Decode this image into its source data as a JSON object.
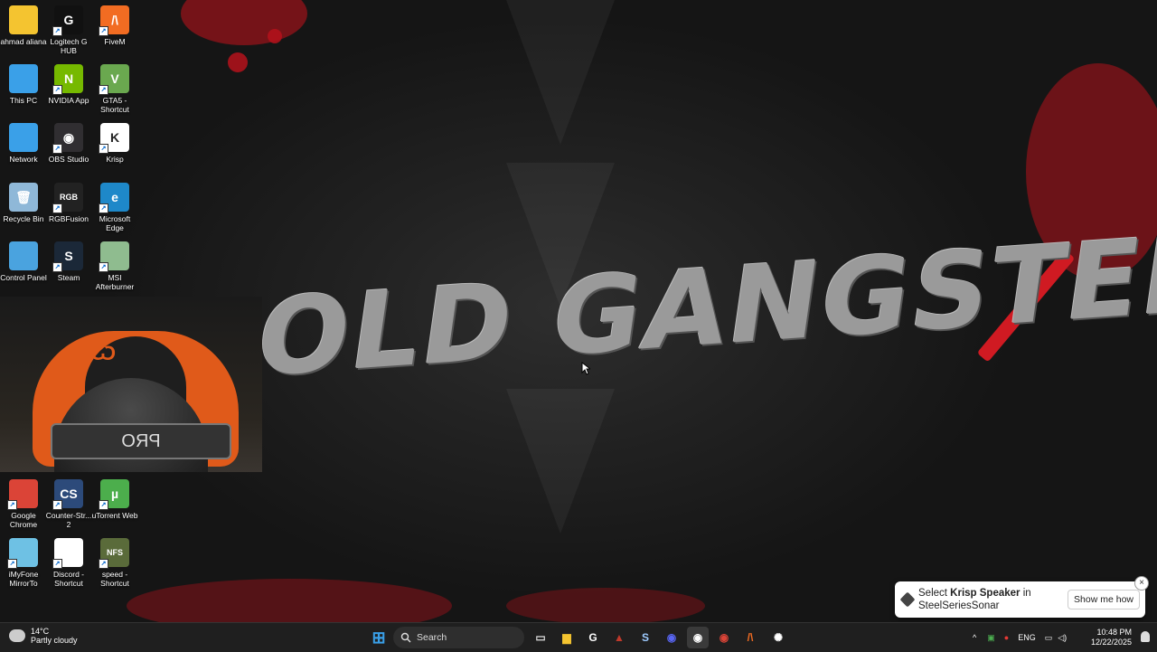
{
  "wallpaper": {
    "title": "OLD GANGSTER'S"
  },
  "desktop_icons": [
    {
      "label": "ahmad aliana",
      "glyph": "",
      "icon": "folder-icon",
      "color": "#f4c430"
    },
    {
      "label": "Logitech G HUB",
      "glyph": "G",
      "icon": "logitech-g-hub-icon",
      "color": "#111111"
    },
    {
      "label": "FiveM",
      "glyph": "/\\",
      "icon": "fivem-icon",
      "color": "#f26c22"
    },
    {
      "label": "This PC",
      "glyph": "",
      "icon": "monitor-icon",
      "color": "#3aa0e8"
    },
    {
      "label": "NVIDIA App",
      "glyph": "N",
      "icon": "nvidia-icon",
      "color": "#76b900"
    },
    {
      "label": "GTA5 - Shortcut",
      "glyph": "V",
      "icon": "gta5-icon",
      "color": "#6aa84f"
    },
    {
      "label": "Network",
      "glyph": "",
      "icon": "network-icon",
      "color": "#3aa0e8"
    },
    {
      "label": "OBS Studio",
      "glyph": "◉",
      "icon": "obs-icon",
      "color": "#302e31"
    },
    {
      "label": "Krisp",
      "glyph": "K",
      "icon": "krisp-icon",
      "color": "#ffffff"
    },
    {
      "label": "Recycle Bin",
      "glyph": "🗑",
      "icon": "recycle-bin-icon",
      "color": "#8fb8d8"
    },
    {
      "label": "RGBFusion",
      "glyph": "RGB",
      "icon": "rgbfusion-icon",
      "color": "#222222"
    },
    {
      "label": "Microsoft Edge",
      "glyph": "e",
      "icon": "edge-icon",
      "color": "#1e88c9"
    },
    {
      "label": "Control Panel",
      "glyph": "",
      "icon": "control-panel-icon",
      "color": "#4aa3df"
    },
    {
      "label": "Steam",
      "glyph": "S",
      "icon": "steam-icon",
      "color": "#1b2838"
    },
    {
      "label": "MSI Afterburner",
      "glyph": "",
      "icon": "msi-afterburner-icon",
      "color": "#8fbc8f"
    },
    {
      "label": "Google Chrome",
      "glyph": "",
      "icon": "chrome-icon",
      "color": "#db4437"
    },
    {
      "label": "Counter-Str... 2",
      "glyph": "CS",
      "icon": "counter-strike-icon",
      "color": "#2c4a7a"
    },
    {
      "label": "uTorrent Web",
      "glyph": "µ",
      "icon": "utorrent-icon",
      "color": "#4cae4c"
    },
    {
      "label": "iMyFone MirrorTo",
      "glyph": "",
      "icon": "mirrorto-icon",
      "color": "#6ec1e4"
    },
    {
      "label": "Discord - Shortcut",
      "glyph": "",
      "icon": "blank-file-icon",
      "color": "#ffffff"
    },
    {
      "label": "speed - Shortcut",
      "glyph": "NFS",
      "icon": "nfs-icon",
      "color": "#5a6b3a"
    }
  ],
  "webcam": {
    "chair_logo": "Ѡ",
    "headband": "PRO"
  },
  "toast": {
    "prefix": "Select ",
    "bold": "Krisp Speaker",
    "suffix": " in",
    "line2": "SteelSeriesSonar",
    "button": "Show me how",
    "close": "×"
  },
  "taskbar": {
    "weather_temp": "14°C",
    "weather_desc": "Partly cloudy",
    "search_placeholder": "Search",
    "apps": [
      {
        "name": "start",
        "glyph": "⊞",
        "color": "#3aa0e8"
      },
      {
        "name": "task-view",
        "glyph": "▭",
        "color": "#dddddd"
      },
      {
        "name": "file-explorer",
        "glyph": "▆",
        "color": "#f4c430"
      },
      {
        "name": "logitech",
        "glyph": "G",
        "color": "#ffffff"
      },
      {
        "name": "app-red",
        "glyph": "▲",
        "color": "#c0392b"
      },
      {
        "name": "steam",
        "glyph": "S",
        "color": "#9ecbff"
      },
      {
        "name": "discord",
        "glyph": "◉",
        "color": "#5865f2"
      },
      {
        "name": "obs",
        "glyph": "◉",
        "color": "#ffffff"
      },
      {
        "name": "chrome",
        "glyph": "◉",
        "color": "#db4437"
      },
      {
        "name": "fivem",
        "glyph": "/\\",
        "color": "#f26c22"
      },
      {
        "name": "steelseries",
        "glyph": "✺",
        "color": "#ffffff"
      }
    ],
    "language": "ENG",
    "time": "10:48 PM",
    "date": "12/22/2025"
  }
}
